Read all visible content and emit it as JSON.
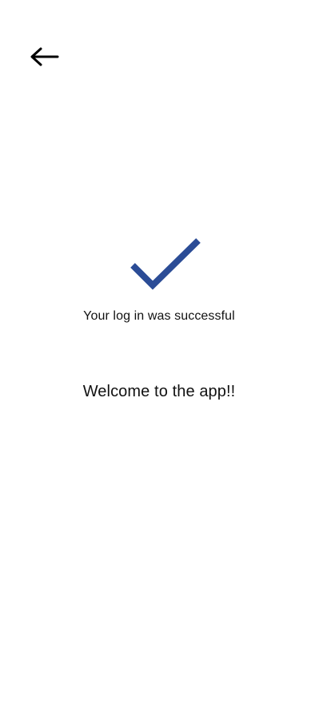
{
  "header": {
    "back_icon": "arrow-left-icon"
  },
  "status": {
    "icon": "checkmark-icon",
    "icon_color": "#2B4C96",
    "message": "Your log in was successful"
  },
  "welcome": {
    "text": "Welcome to the app!!"
  }
}
